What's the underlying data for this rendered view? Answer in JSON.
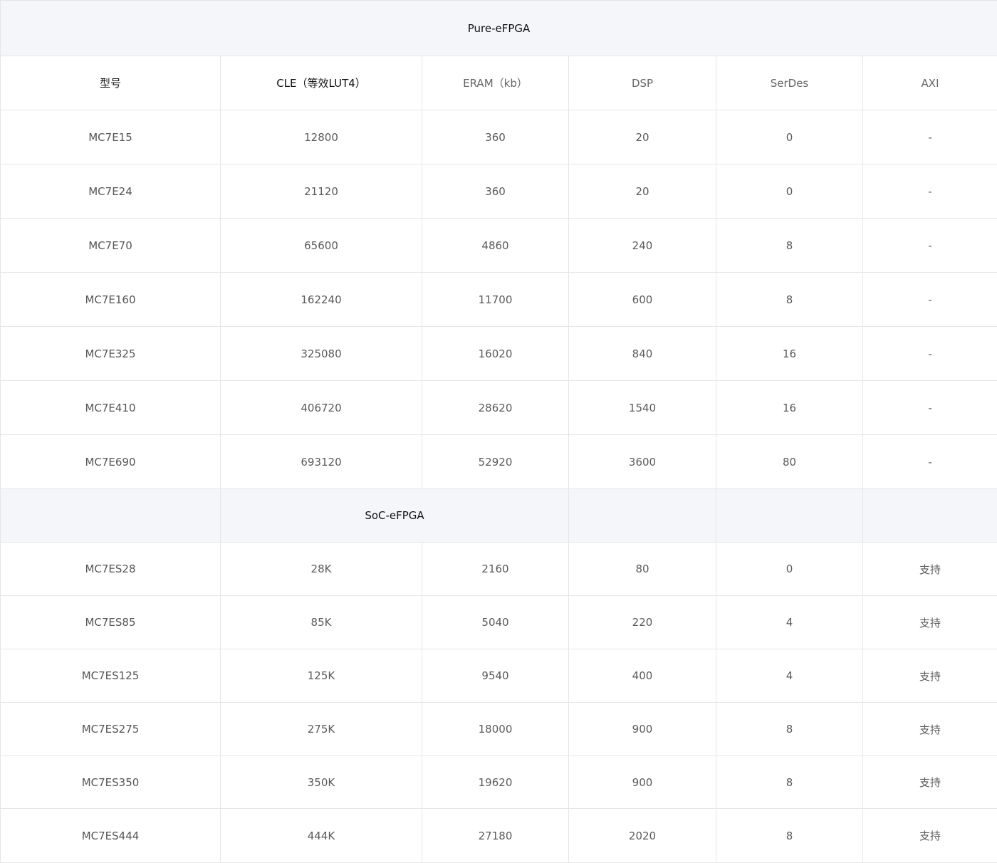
{
  "pure_section": {
    "title": "Pure-eFPGA"
  },
  "header": {
    "model": "型号",
    "cle": "CLE（等效LUT4）",
    "eram": "ERAM（kb）",
    "dsp": "DSP",
    "serdes": "SerDes",
    "axi": "AXI"
  },
  "pure_rows": [
    {
      "model": "MC7E15",
      "cle": "12800",
      "eram": "360",
      "dsp": "20",
      "serdes": "0",
      "axi": "-"
    },
    {
      "model": "MC7E24",
      "cle": "21120",
      "eram": "360",
      "dsp": "20",
      "serdes": "0",
      "axi": "-"
    },
    {
      "model": "MC7E70",
      "cle": "65600",
      "eram": "4860",
      "dsp": "240",
      "serdes": "8",
      "axi": "-"
    },
    {
      "model": "MC7E160",
      "cle": "162240",
      "eram": "11700",
      "dsp": "600",
      "serdes": "8",
      "axi": "-"
    },
    {
      "model": "MC7E325",
      "cle": "325080",
      "eram": "16020",
      "dsp": "840",
      "serdes": "16",
      "axi": "-"
    },
    {
      "model": "MC7E410",
      "cle": "406720",
      "eram": "28620",
      "dsp": "1540",
      "serdes": "16",
      "axi": "-"
    },
    {
      "model": "MC7E690",
      "cle": "693120",
      "eram": "52920",
      "dsp": "3600",
      "serdes": "80",
      "axi": "-"
    }
  ],
  "soc_section": {
    "title": "SoC-eFPGA"
  },
  "soc_rows": [
    {
      "model": "MC7ES28",
      "cle": "28K",
      "eram": "2160",
      "dsp": "80",
      "serdes": "0",
      "axi": "支持"
    },
    {
      "model": "MC7ES85",
      "cle": "85K",
      "eram": "5040",
      "dsp": "220",
      "serdes": "4",
      "axi": "支持"
    },
    {
      "model": "MC7ES125",
      "cle": "125K",
      "eram": "9540",
      "dsp": "400",
      "serdes": "4",
      "axi": "支持"
    },
    {
      "model": "MC7ES275",
      "cle": "275K",
      "eram": "18000",
      "dsp": "900",
      "serdes": "8",
      "axi": "支持"
    },
    {
      "model": "MC7ES350",
      "cle": "350K",
      "eram": "19620",
      "dsp": "900",
      "serdes": "8",
      "axi": "支持"
    },
    {
      "model": "MC7ES444",
      "cle": "444K",
      "eram": "27180",
      "dsp": "2020",
      "serdes": "8",
      "axi": "支持"
    }
  ]
}
